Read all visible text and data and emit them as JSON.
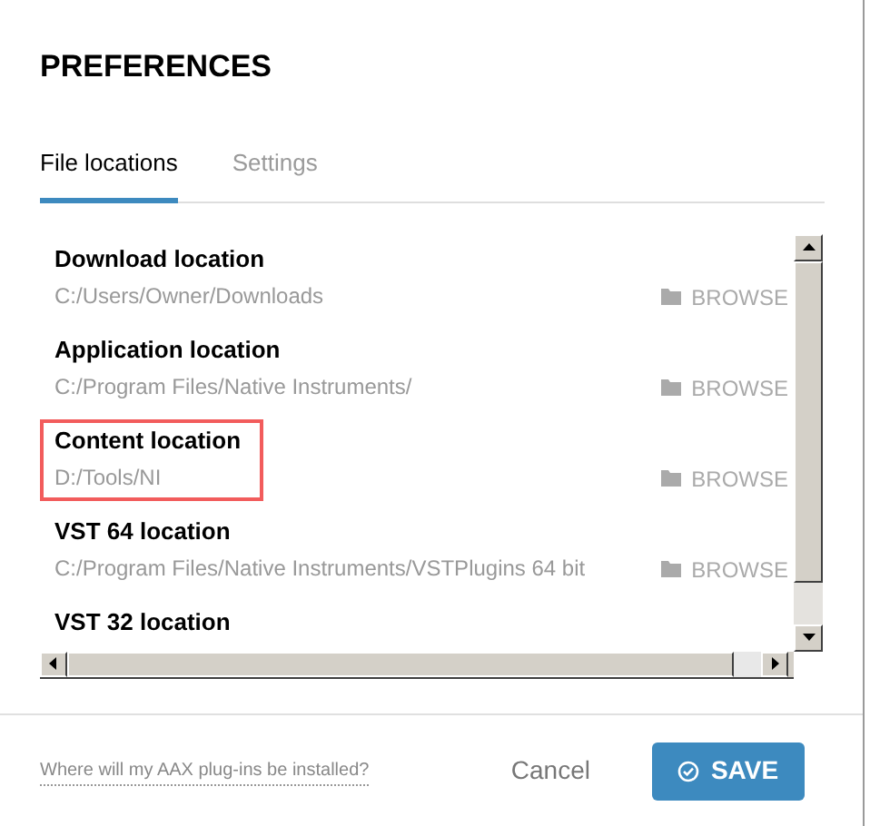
{
  "title": "PREFERENCES",
  "tabs": [
    {
      "label": "File locations",
      "selected": true
    },
    {
      "label": "Settings",
      "selected": false
    }
  ],
  "locations": [
    {
      "name": "Download location",
      "path": "C:/Users/Owner/Downloads",
      "action": "BROWSE",
      "highlighted": false
    },
    {
      "name": "Application location",
      "path": "C:/Program Files/Native Instruments/",
      "action": "BROWSE",
      "highlighted": false
    },
    {
      "name": "Content location",
      "path": "D:/Tools/NI",
      "action": "BROWSE",
      "highlighted": true
    },
    {
      "name": "VST 64 location",
      "path": "C:/Program Files/Native Instruments/VSTPlugins 64 bit",
      "action": "BROWSE",
      "highlighted": false
    },
    {
      "name": "VST 32 location",
      "highlighted": false
    }
  ],
  "footer": {
    "link": "Where will my AAX plug-ins be installed?",
    "cancel": "Cancel",
    "save": "SAVE"
  }
}
